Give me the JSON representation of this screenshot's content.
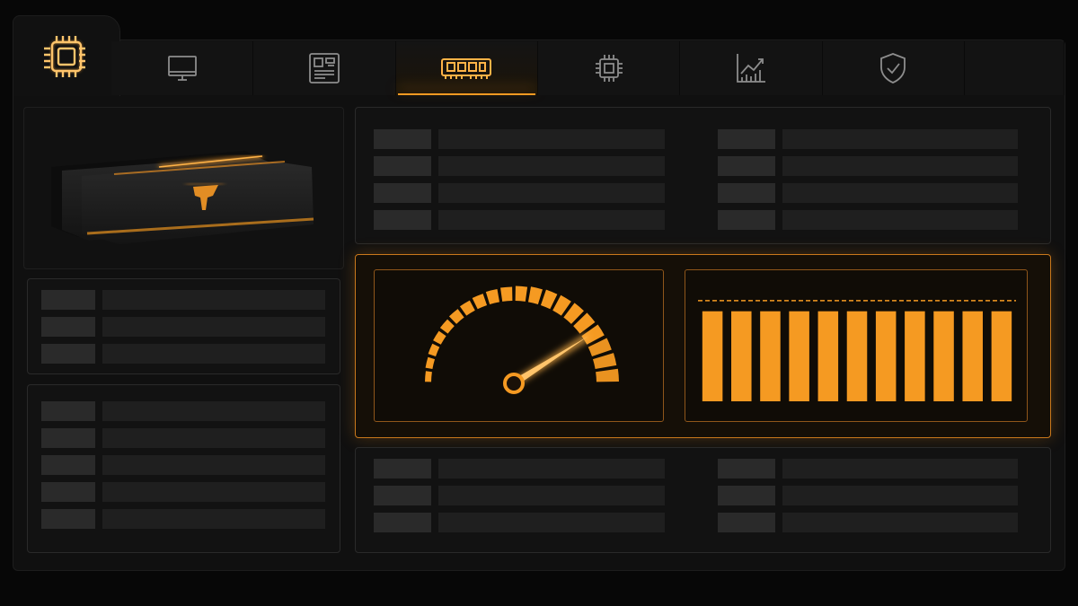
{
  "theme": {
    "accent": "#f59a22",
    "accent_glow": "#ffb347",
    "background": "#070707",
    "panel": "#121212",
    "placeholder_key": "#2a2a2a",
    "placeholder_value": "#1f1f1f"
  },
  "tabs": [
    {
      "icon": "cpu-chip-icon",
      "active": false
    },
    {
      "icon": "monitor-icon",
      "active": false
    },
    {
      "icon": "motherboard-icon",
      "active": false
    },
    {
      "icon": "ram-module-icon",
      "active": true
    },
    {
      "icon": "processor-icon",
      "active": false
    },
    {
      "icon": "chart-trend-icon",
      "active": false
    },
    {
      "icon": "shield-check-icon",
      "active": false
    }
  ],
  "product": {
    "icon": "ram-kit-image"
  },
  "gauge": {
    "level": 0.82,
    "segments": 20
  },
  "bars": {
    "count": 11,
    "level": 0.85,
    "threshold": 0.95
  }
}
